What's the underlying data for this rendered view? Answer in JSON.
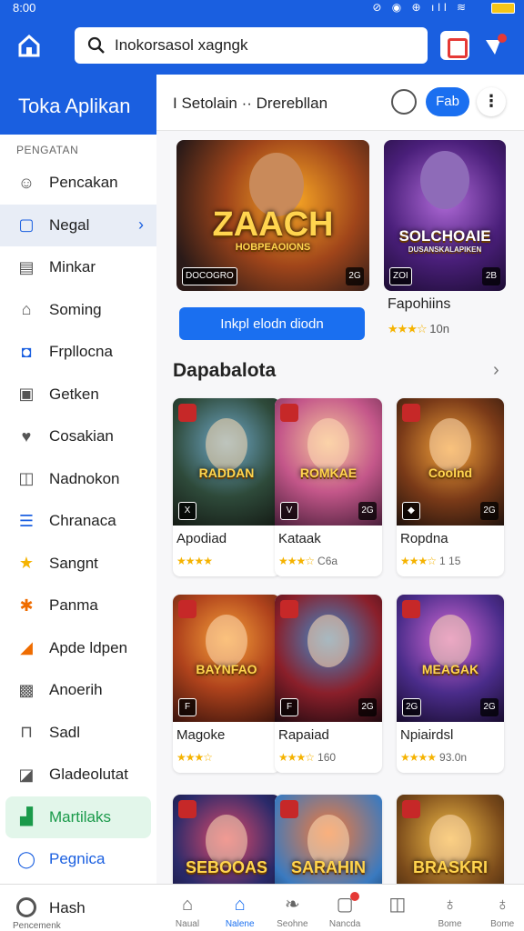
{
  "status": {
    "time": "8:00",
    "icons": "⊘ ◉ ⊕ ıll ≋"
  },
  "topbar": {
    "search_value": "Inokorsasol xagngk"
  },
  "sidebar": {
    "brand": "Toka Aplikan",
    "section": "PENGATAN",
    "items": [
      {
        "label": "Pencakan",
        "icon": "person-icon",
        "glyph": "☺"
      },
      {
        "label": "Negal",
        "icon": "square-icon",
        "glyph": "▢"
      },
      {
        "label": "Minkar",
        "icon": "document-icon",
        "glyph": "▤"
      },
      {
        "label": "Soming",
        "icon": "building-icon",
        "glyph": "⌂"
      },
      {
        "label": "Frpllocna",
        "icon": "blue-square-icon",
        "glyph": "◘"
      },
      {
        "label": "Getken",
        "icon": "square-outline-icon",
        "glyph": "▣"
      },
      {
        "label": "Cosakian",
        "icon": "heart-icon",
        "glyph": "♥"
      },
      {
        "label": "Nadnokon",
        "icon": "frame-icon",
        "glyph": "◫"
      },
      {
        "label": "Chranaca",
        "icon": "list-icon",
        "glyph": "☰"
      },
      {
        "label": "Sangnt",
        "icon": "star-icon",
        "glyph": "★"
      },
      {
        "label": "Panma",
        "icon": "people-icon",
        "glyph": "✱"
      },
      {
        "label": "Apde ldpen",
        "icon": "photo-icon",
        "glyph": "◢"
      },
      {
        "label": "Anoerih",
        "icon": "image-icon",
        "glyph": "▩"
      },
      {
        "label": "Sadl",
        "icon": "bag-icon",
        "glyph": "⊓"
      },
      {
        "label": "Gladeolutat",
        "icon": "bookmark-icon",
        "glyph": "◪"
      },
      {
        "label": "Martilaks",
        "icon": "green-app-icon",
        "glyph": "▟"
      },
      {
        "label": "Pegnica",
        "icon": "chat-icon",
        "glyph": "◯"
      }
    ]
  },
  "main": {
    "header_title": "I Setolain  ··  Drerebllan",
    "pill": "Fab",
    "more": "⋮",
    "featured1": {
      "logo": "ZAACH",
      "sub": "HOBPEAOIONS",
      "badge_bl": "DOCOGRO",
      "badge_br": "2G"
    },
    "install_label": "Inkpl elodn diodn",
    "featured2": {
      "logo": "SOLCHOAIE",
      "sub": "DUSANSKALAPIKEN",
      "badge_bl": "ZOI",
      "badge_br": "2B",
      "title": "Fapohiins",
      "stars": "★★★☆",
      "rating": "10n"
    },
    "section_title": "Dapabalota",
    "section_arrow": "›",
    "cards": [
      {
        "name": "Apodiad",
        "stars": "★★★★",
        "rating": "",
        "logo": "RADDAN",
        "bl": "X",
        "br": ""
      },
      {
        "name": "Kataak",
        "stars": "★★★☆",
        "rating": "C6a",
        "logo": "ROMKAE",
        "bl": "V",
        "br": "2G"
      },
      {
        "name": "Ropdna",
        "stars": "★★★☆",
        "rating": "1 15",
        "logo": "Coolnd",
        "bl": "◆",
        "br": "2G"
      },
      {
        "name": "Magoke",
        "stars": "★★★☆",
        "rating": "",
        "logo": "BAYNFAO",
        "bl": "F",
        "br": ""
      },
      {
        "name": "Rapaiad",
        "stars": "★★★☆",
        "rating": "160",
        "logo": "",
        "bl": "F",
        "br": "2G"
      },
      {
        "name": "Npiairdsl",
        "stars": "★★★★",
        "rating": "93.0n",
        "logo": "MEAGAK",
        "bl": "2G",
        "br": "2G"
      },
      {
        "name": "",
        "stars": "",
        "rating": "",
        "logo": "SEBOOAS",
        "bl": "",
        "br": ""
      },
      {
        "name": "",
        "stars": "",
        "rating": "",
        "logo": "SARAHIN",
        "bl": "",
        "br": ""
      },
      {
        "name": "",
        "stars": "",
        "rating": "",
        "logo": "BRASKRI",
        "bl": "",
        "br": ""
      }
    ]
  },
  "bottomnav": {
    "first_label": "Hash",
    "first_sub": "Pencemenk",
    "items": [
      {
        "label": "Naual",
        "icon": "home-outline-icon",
        "glyph": "⌂"
      },
      {
        "label": "Nalene",
        "icon": "home-icon",
        "glyph": "⌂"
      },
      {
        "label": "Seohne",
        "icon": "leaf-icon",
        "glyph": "❧"
      },
      {
        "label": "Nancda",
        "icon": "notification-icon",
        "glyph": "▢"
      },
      {
        "label": "",
        "icon": "gift-icon",
        "glyph": "◫"
      },
      {
        "label": "Bome",
        "icon": "user-icon",
        "glyph": "♁"
      },
      {
        "label": "Bome",
        "icon": "profile-icon",
        "glyph": "♁"
      }
    ]
  },
  "colors": {
    "brand_blue": "#1a5fe0",
    "accent_blue": "#1a6ff0",
    "star": "#f5b301"
  }
}
